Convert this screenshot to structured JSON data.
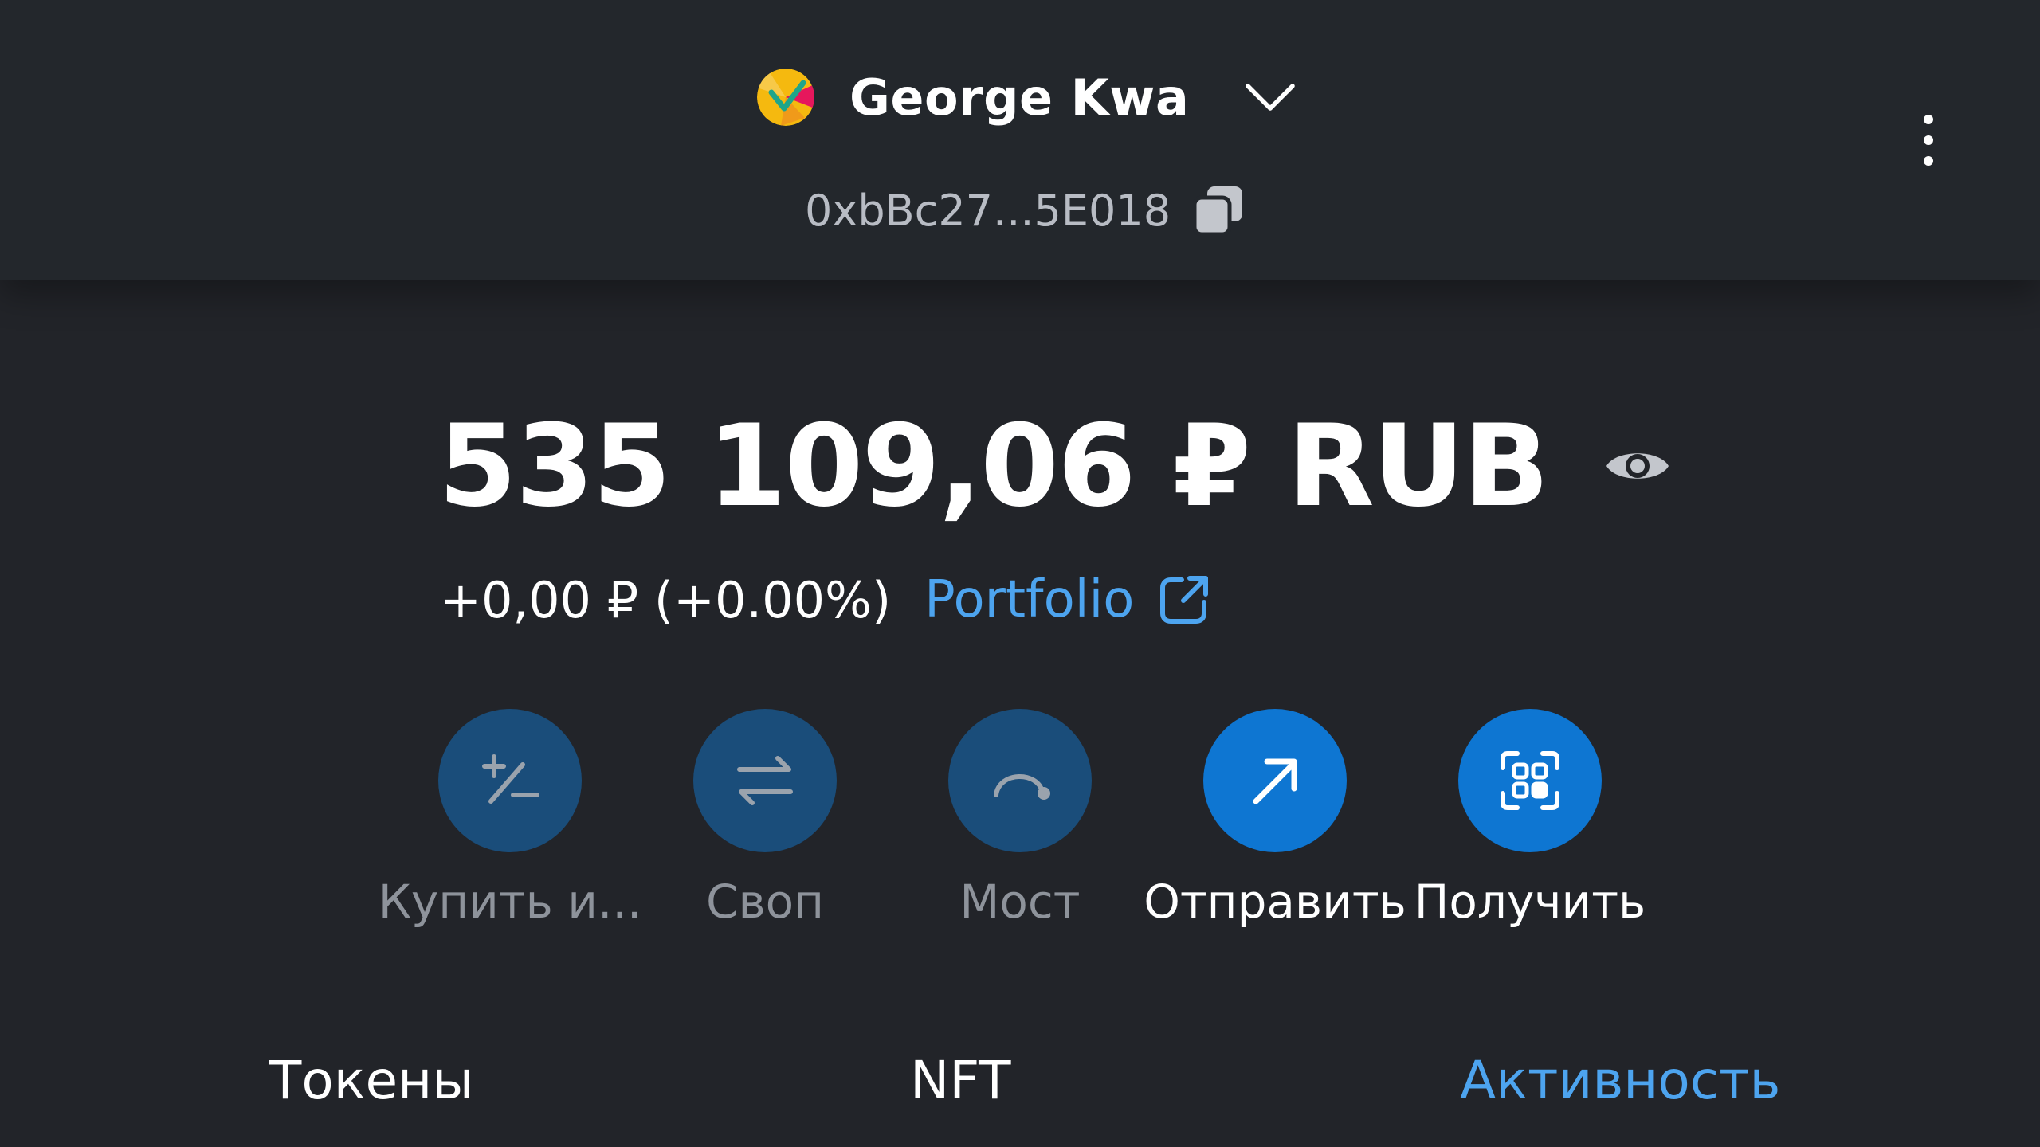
{
  "header": {
    "account_name": "George Kwa",
    "address": "0xbBc27...5E018"
  },
  "balance": {
    "amount": "535 109,06 ₽ RUB",
    "change": "+0,00 ₽ (+0.00%)",
    "portfolio_label": "Portfolio"
  },
  "actions": [
    {
      "label": "Купить и...",
      "icon": "plus-minus-icon",
      "enabled": false
    },
    {
      "label": "Своп",
      "icon": "swap-arrows-icon",
      "enabled": false
    },
    {
      "label": "Мост",
      "icon": "bridge-icon",
      "enabled": false
    },
    {
      "label": "Отправить",
      "icon": "arrow-up-right-icon",
      "enabled": true
    },
    {
      "label": "Получить",
      "icon": "scan-qr-icon",
      "enabled": true
    }
  ],
  "tabs": [
    {
      "label": "Токены",
      "active": false
    },
    {
      "label": "NFT",
      "active": false
    },
    {
      "label": "Активность",
      "active": true
    }
  ],
  "colors": {
    "background": "#222429",
    "header_background": "#23272c",
    "accent_blue": "#4da4ef",
    "button_enabled": "#0e76d2",
    "button_disabled": "#1a4d7a",
    "text_muted": "#8e939b"
  }
}
